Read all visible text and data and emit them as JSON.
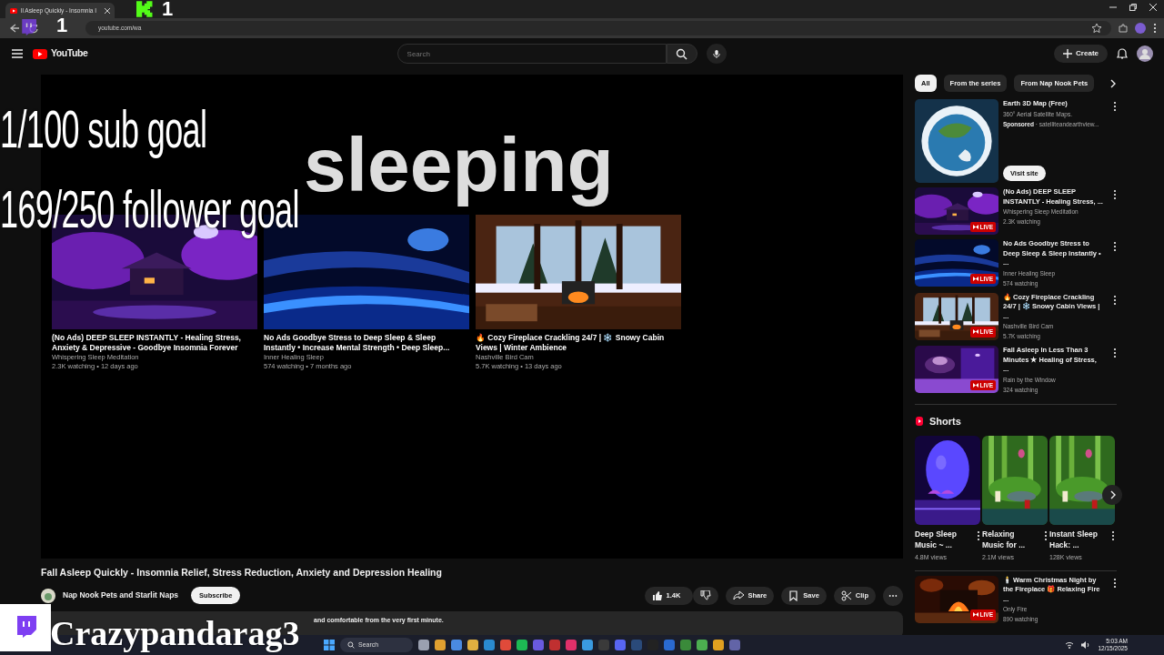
{
  "browser": {
    "tab_title": "ll Asleep Quickly - Insomnia I",
    "url": "youtube.com/wa"
  },
  "header": {
    "logo": "YouTube",
    "search": {
      "placeholder": "Search"
    },
    "create": "Create"
  },
  "overlay": {
    "counters": [
      "1",
      "1"
    ],
    "goals": [
      "1/100 sub goal",
      "169/250 follower goal"
    ],
    "status": "sleeping",
    "username": "Crazypandarag3"
  },
  "end_screen": [
    {
      "title": "(No Ads) DEEP SLEEP INSTANTLY - Healing Stress, Anxiety & Depressive - Goodbye Insomnia Forever",
      "channel": "Whispering Sleep Meditation",
      "meta": "2.3K watching • 12 days ago"
    },
    {
      "title": "No Ads Goodbye Stress to Deep Sleep & Sleep Instantly • Increase Mental Strength • Deep Sleep...",
      "channel": "Inner Healing Sleep",
      "meta": "574 watching • 7 months ago"
    },
    {
      "title": "🔥 Cozy Fireplace Crackling 24/7 | ❄️ Snowy Cabin Views | Winter Ambience",
      "channel": "Nashville Bird Cam",
      "meta": "5.7K watching • 13 days ago"
    }
  ],
  "video": {
    "title": "Fall Asleep Quickly - Insomnia Relief, Stress Reduction, Anxiety and Depression Healing",
    "channel": "Nap Nook Pets and Starlit Naps",
    "subscribe": "Subscribe",
    "likes": "1.4K",
    "actions": [
      "Share",
      "Save",
      "Clip"
    ],
    "description": "and comfortable from the very first minute."
  },
  "chips": [
    {
      "label": "All",
      "selected": true
    },
    {
      "label": "From the series",
      "selected": false
    },
    {
      "label": "From Nap Nook Pets",
      "selected": false
    }
  ],
  "ad": {
    "title": "Earth 3D Map (Free)",
    "subtitle": "360° Aerial Satellite Maps.",
    "sponsored": "Sponsored",
    "domain": "· satelliteandearthview...",
    "button": "Visit site"
  },
  "related": [
    {
      "title": "(No Ads) DEEP SLEEP INSTANTLY - Healing Stress, ...",
      "channel": "Whispering Sleep Meditation",
      "meta": "2.3K watching",
      "badge": "LIVE"
    },
    {
      "title": "No Ads Goodbye Stress to Deep Sleep & Sleep Instantly • ...",
      "channel": "Inner Healing Sleep",
      "meta": "574 watching",
      "badge": "LIVE"
    },
    {
      "title": "🔥 Cozy Fireplace Crackling 24/7 | ❄️ Snowy Cabin Views | ...",
      "channel": "Nashville Bird Cam",
      "meta": "5.7K watching",
      "badge": "LIVE"
    },
    {
      "title": "Fall Asleep In Less Than 3 Minutes ★ Healing of Stress, ...",
      "channel": "Rain by the Window",
      "meta": "324 watching",
      "badge": "LIVE"
    }
  ],
  "shorts": {
    "heading": "Shorts",
    "items": [
      {
        "title": "Deep Sleep Music ~ ...",
        "views": "4.8M views"
      },
      {
        "title": "Relaxing Music for ...",
        "views": "2.1M views"
      },
      {
        "title": "Instant Sleep Hack: ...",
        "views": "128K views"
      }
    ]
  },
  "related_more": [
    {
      "title": "🕯️ Warm Christmas Night by the Fireplace 🎁 Relaxing Fire ...",
      "channel": "Only Fire",
      "meta": "890 watching",
      "badge": "LIVE"
    }
  ],
  "taskbar": {
    "search": "Search",
    "time": "5:03 AM",
    "date": "12/15/2025"
  }
}
